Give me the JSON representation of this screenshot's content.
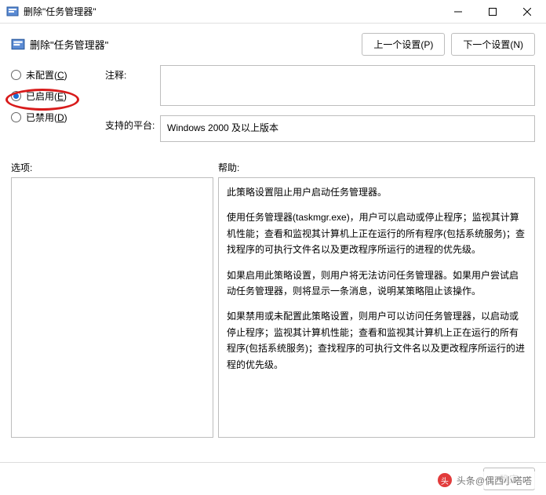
{
  "titlebar": {
    "icon": "gpedit-icon",
    "title": "删除\"任务管理器\"",
    "minimize_icon": "minimize-icon",
    "maximize_icon": "maximize-icon",
    "close_icon": "close-icon"
  },
  "header": {
    "icon": "gpedit-icon",
    "title": "删除\"任务管理器\"",
    "prev_button": "上一个设置(P)",
    "next_button": "下一个设置(N)"
  },
  "radios": {
    "not_configured": {
      "label": "未配置(",
      "access": "C",
      "suffix": ")"
    },
    "enabled": {
      "label": "已启用(",
      "access": "E",
      "suffix": ")"
    },
    "disabled": {
      "label": "已禁用(",
      "access": "D",
      "suffix": ")"
    },
    "selected": "enabled"
  },
  "fields": {
    "comment_label": "注释:",
    "comment_text": "",
    "platform_label": "支持的平台:",
    "platform_text": "Windows 2000 及以上版本"
  },
  "sections": {
    "options_label": "选项:",
    "help_label": "帮助:"
  },
  "help": {
    "p1": "此策略设置阻止用户启动任务管理器。",
    "p2": "使用任务管理器(taskmgr.exe)，用户可以启动或停止程序；监视其计算机性能；查看和监视其计算机上正在运行的所有程序(包括系统服务)；查找程序的可执行文件名以及更改程序所运行的进程的优先级。",
    "p3": "如果启用此策略设置，则用户将无法访问任务管理器。如果用户尝试启动任务管理器，则将显示一条消息，说明某策略阻止该操作。",
    "p4": "如果禁用或未配置此策略设置，则用户可以访问任务管理器，以启动或停止程序；监视其计算机性能；查看和监视其计算机上正在运行的所有程序(包括系统服务)；查找程序的可执行文件名以及更改程序所运行的进程的优先级。"
  },
  "footer": {
    "ok": "确定"
  },
  "watermark": {
    "logo_text": "头",
    "text": "头条@偶西小嗒嗒"
  }
}
